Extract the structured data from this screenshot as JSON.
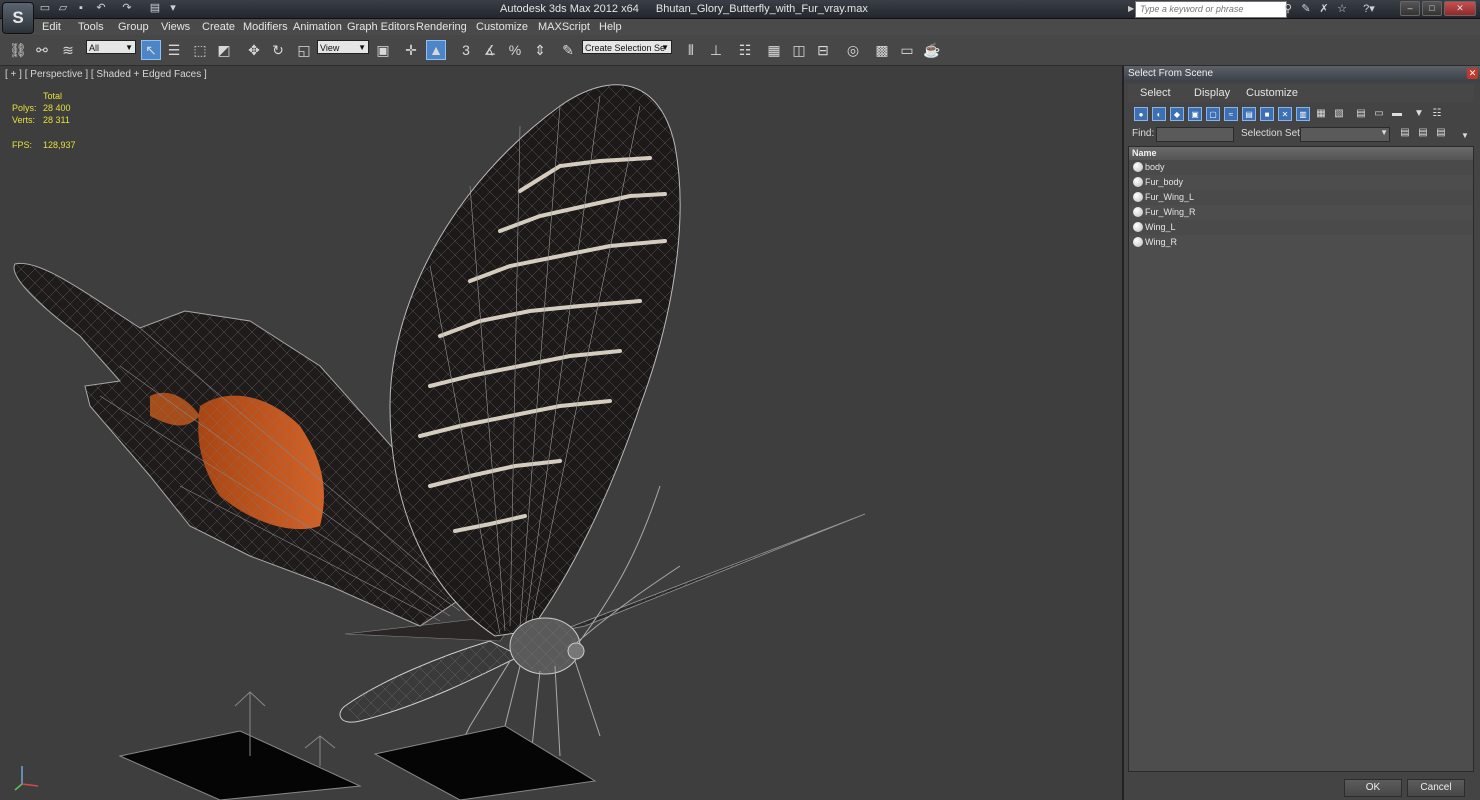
{
  "window": {
    "app_title": "Autodesk 3ds Max  2012 x64",
    "file_title": "Bhutan_Glory_Butterfly_with_Fur_vray.max",
    "logo": "3ds Max logo",
    "search_placeholder": "Type a keyword or phrase"
  },
  "menu": [
    "Edit",
    "Tools",
    "Group",
    "Views",
    "Create",
    "Modifiers",
    "Animation",
    "Graph Editors",
    "Rendering",
    "Customize",
    "MAXScript",
    "Help"
  ],
  "toolbar": {
    "filter_value": "All",
    "coord_value": "View",
    "named_selection_placeholder": "Create Selection Se"
  },
  "viewport": {
    "label": "[ + ] [ Perspective ] [ Shaded + Edged Faces ]",
    "stats": {
      "total_label": "Total",
      "polys_label": "Polys:",
      "polys_value": "28 400",
      "verts_label": "Verts:",
      "verts_value": "28 311",
      "fps_label": "FPS:",
      "fps_value": "128,937"
    }
  },
  "select_panel": {
    "title": "Select From Scene",
    "menu": [
      "Select",
      "Display",
      "Customize"
    ],
    "find_label": "Find:",
    "selection_set_label": "Selection Set:",
    "column_name": "Name",
    "objects": [
      "body",
      "Fur_body",
      "Fur_Wing_L",
      "Fur_Wing_R",
      "Wing_L",
      "Wing_R"
    ],
    "ok_label": "OK",
    "cancel_label": "Cancel"
  },
  "colors": {
    "stats_text": "#e3e03a",
    "active_tool": "#4d86c8",
    "viewport_bg": "#3e3e3e"
  }
}
